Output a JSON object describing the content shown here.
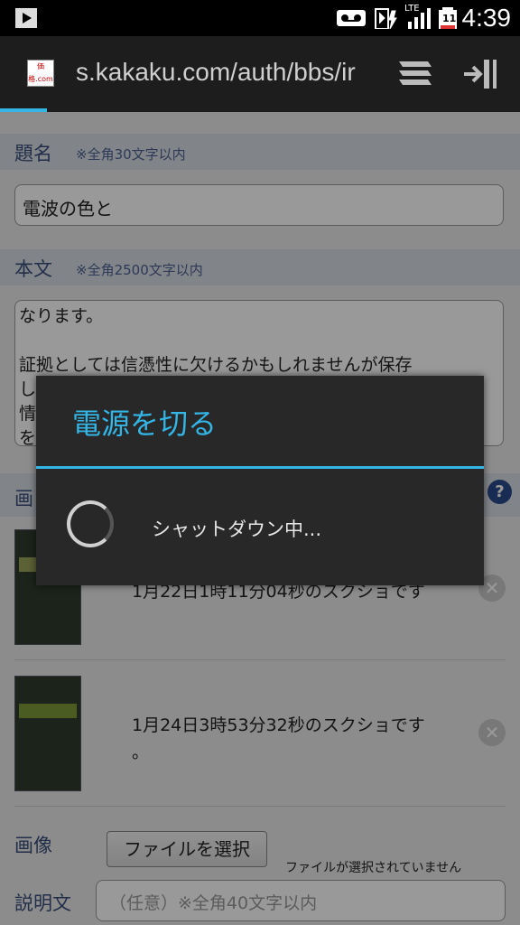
{
  "status_bar": {
    "time": "4:39",
    "lte_label": "LTE",
    "battery_level": "11"
  },
  "browser": {
    "url": "s.kakaku.com/auth/bbs/ir",
    "favicon_text": "価格.com"
  },
  "form": {
    "title_label": "題名",
    "title_note": "※全角30文字以内",
    "title_value": "電波の色と",
    "body_label": "本文",
    "body_note": "※全角2500文字以内",
    "body_text": "なります。\n\n証拠としては信憑性に欠けるかもしれませんが保存\nし\n情\nを",
    "images_label": "画",
    "help": "?",
    "images": [
      {
        "caption": "1月22日1時11分04秒のスクショです"
      },
      {
        "caption": "1月24日3時53分32秒のスクショです",
        "caption_cont": "。"
      }
    ],
    "delete_glyph": "✕",
    "image_label": "画像",
    "file_button": "ファイルを選択",
    "no_file": "ファイルが選択されていません",
    "desc_label": "説明文",
    "desc_placeholder": "（任意）※全角40文字以内"
  },
  "dialog": {
    "title": "電源を切る",
    "message": "シャットダウン中..."
  },
  "colors": {
    "accent": "#33b5e5",
    "dialog_bg": "#282828",
    "section_bg": "#d7dde4"
  }
}
